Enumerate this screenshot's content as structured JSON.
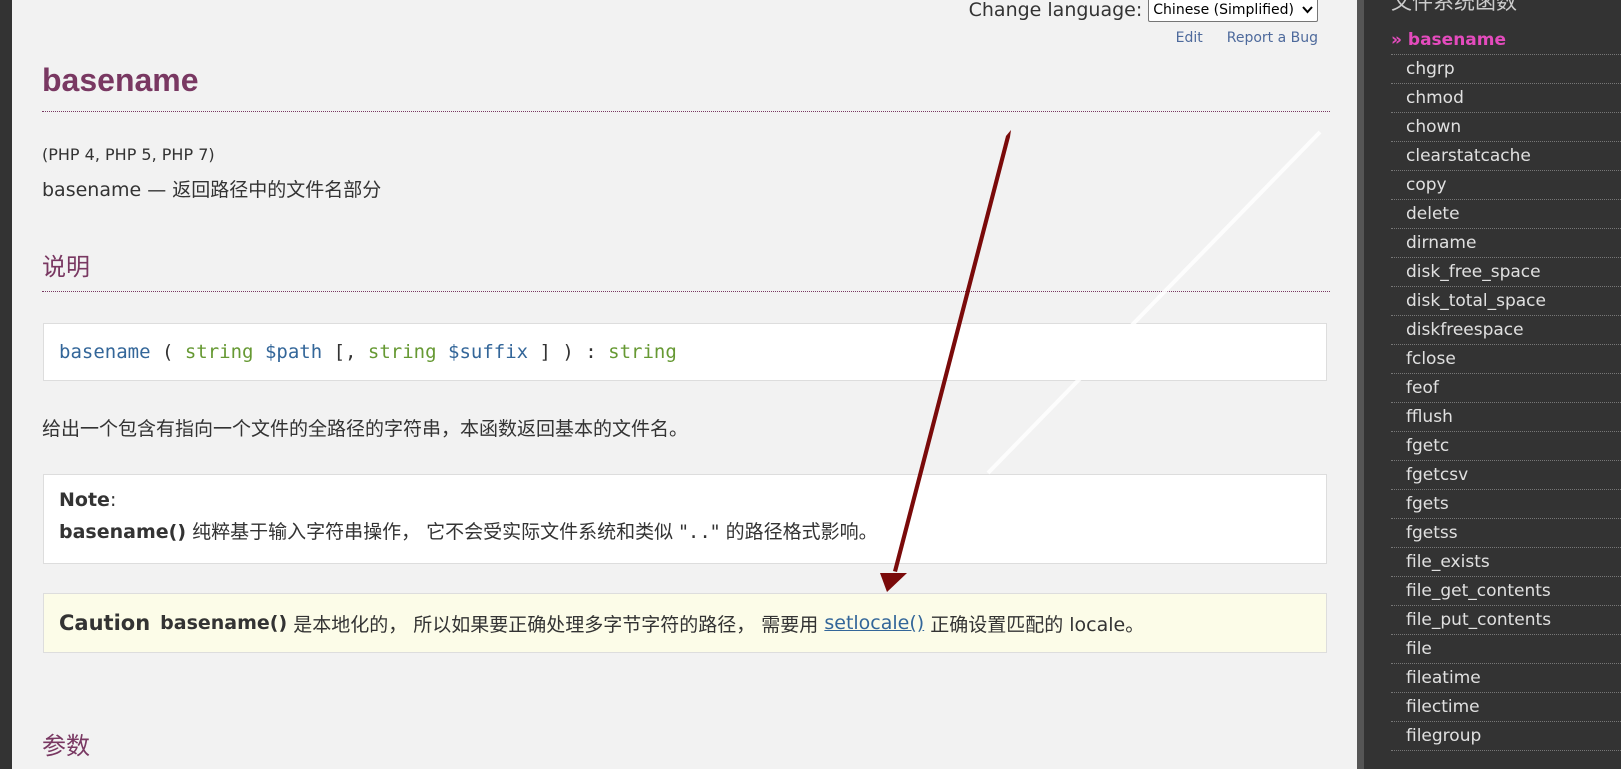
{
  "header": {
    "change_language_label": "Change language:",
    "language_selected": "Chinese (Simplified)",
    "edit_link": "Edit",
    "report_bug_link": "Report a Bug"
  },
  "page": {
    "title": "basename",
    "version": "(PHP 4, PHP 5, PHP 7)",
    "refpurpose": "basename — 返回路径中的文件名部分",
    "section_description": "说明",
    "section_parameters": "参数"
  },
  "signature": {
    "function": "basename",
    "open": " ( ",
    "type1": "string",
    "var1": "$path",
    "bracket_open": " [, ",
    "type2": "string",
    "var2": "$suffix",
    "bracket_close": " ] ) : ",
    "return_type": "string"
  },
  "description_text": "给出一个包含有指向一个文件的全路径的字符串，本函数返回基本的文件名。",
  "note": {
    "title": "Note",
    "colon": ":",
    "func": "basename()",
    "text_before": " 纯粹基于输入字符串操作， 它不会受实际文件系统和类似 \"",
    "code": "..",
    "text_after": "\" 的路径格式影响。"
  },
  "caution": {
    "title": "Caution",
    "func": "basename()",
    "text_before": " 是本地化的， 所以如果要正确处理多字节字符的路径， 需要用 ",
    "link": "setlocale()",
    "text_after": " 正确设置匹配的 locale。"
  },
  "sidebar": {
    "heading": "文件系统函数",
    "items": [
      {
        "label": "» basename",
        "current": true
      },
      {
        "label": "chgrp"
      },
      {
        "label": "chmod"
      },
      {
        "label": "chown"
      },
      {
        "label": "clearstatcache"
      },
      {
        "label": "copy"
      },
      {
        "label": "delete"
      },
      {
        "label": "dirname"
      },
      {
        "label": "disk_free_space"
      },
      {
        "label": "disk_total_space"
      },
      {
        "label": "diskfreespace"
      },
      {
        "label": "fclose"
      },
      {
        "label": "feof"
      },
      {
        "label": "fflush"
      },
      {
        "label": "fgetc"
      },
      {
        "label": "fgetcsv"
      },
      {
        "label": "fgets"
      },
      {
        "label": "fgetss"
      },
      {
        "label": "file_exists"
      },
      {
        "label": "file_get_contents"
      },
      {
        "label": "file_put_contents"
      },
      {
        "label": "file"
      },
      {
        "label": "fileatime"
      },
      {
        "label": "filectime"
      },
      {
        "label": "filegroup"
      }
    ]
  },
  "colors": {
    "accent": "#793862",
    "sidebar_current": "#e44bbd",
    "arrow": "#7a0a0a"
  }
}
